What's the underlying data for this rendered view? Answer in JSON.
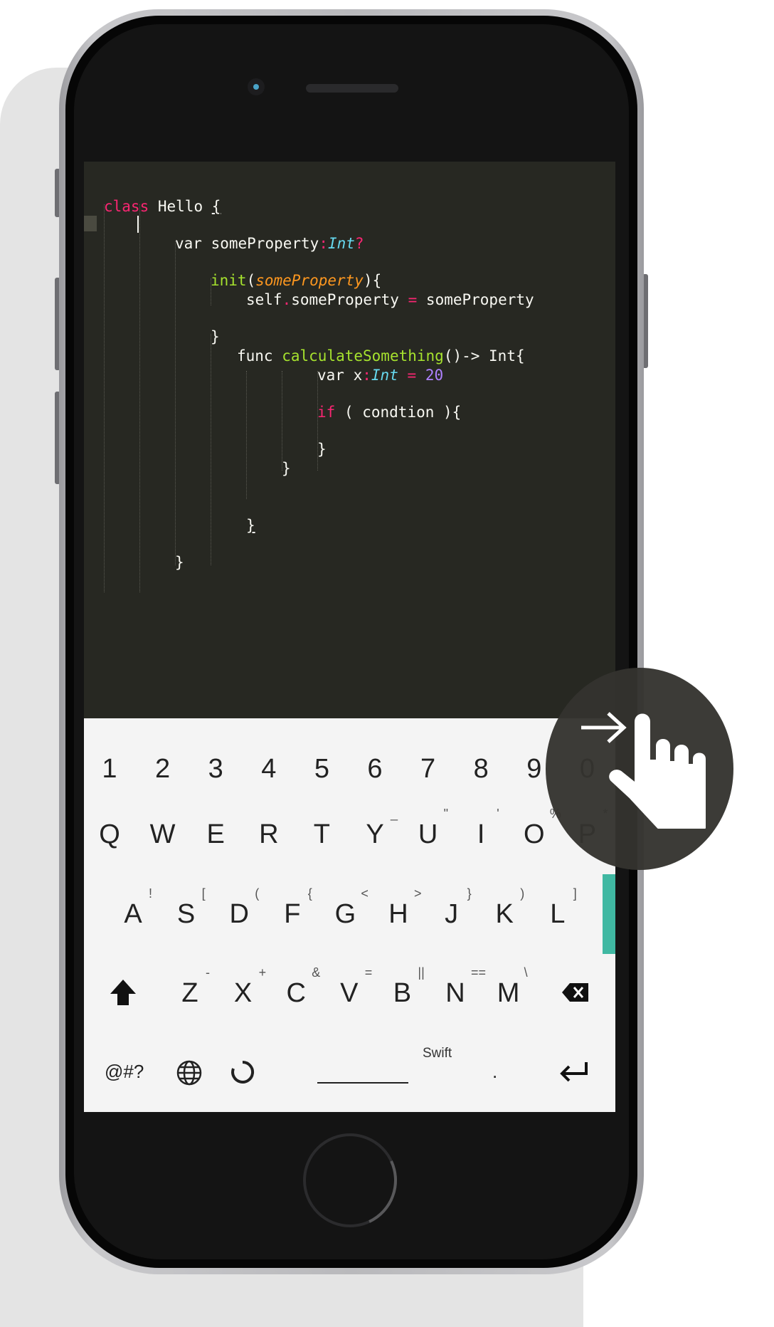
{
  "editor": {
    "lines": [
      {
        "text": "class Hello {"
      },
      {
        "text": "var someProperty:Int?"
      },
      {
        "text": "init(someProperty){"
      },
      {
        "text": "self.someProperty = someProperty"
      },
      {
        "text": "}"
      },
      {
        "text": "func calculateSomething()-> Int{"
      },
      {
        "text": "var x:Int = 20"
      },
      {
        "text": "if ( condtion ){"
      },
      {
        "text": "}"
      },
      {
        "text": "}"
      },
      {
        "text": "}"
      },
      {
        "text": "}"
      }
    ],
    "tokens": {
      "class": "class",
      "hello": "Hello",
      "brace_open": "{",
      "var": "var",
      "some_property": "someProperty",
      "colon": ":",
      "int": "Int",
      "qmark": "?",
      "init": "init",
      "paren_open": "(",
      "param": "someProperty",
      "paren_close_brace": "){",
      "self": "self",
      "dot": ".",
      "eq": "=",
      "assign_val": "someProperty",
      "func": "func",
      "fn_name": "calculateSomething",
      "arrow": "()-> Int{",
      "x": "x",
      "twenty": "20",
      "if": "if",
      "cond": " ( condtion ){",
      "close": "}"
    },
    "colors": {
      "background": "#272822",
      "keyword": "#f92672",
      "function": "#a6e22e",
      "type": "#66d9ef",
      "param": "#fd971f",
      "number": "#ae81ff"
    }
  },
  "keyboard": {
    "number_row": [
      "1",
      "2",
      "3",
      "4",
      "5",
      "6",
      "7",
      "8",
      "9",
      "0"
    ],
    "row1": [
      {
        "key": "Q",
        "hint": ""
      },
      {
        "key": "W",
        "hint": ""
      },
      {
        "key": "E",
        "hint": ""
      },
      {
        "key": "R",
        "hint": ""
      },
      {
        "key": "T",
        "hint": ""
      },
      {
        "key": "Y",
        "hint": "_"
      },
      {
        "key": "U",
        "hint": "\""
      },
      {
        "key": "I",
        "hint": "'"
      },
      {
        "key": "O",
        "hint": "%"
      },
      {
        "key": "P",
        "hint": "*"
      }
    ],
    "row2": [
      {
        "key": "A",
        "hint": "!"
      },
      {
        "key": "S",
        "hint": "["
      },
      {
        "key": "D",
        "hint": "("
      },
      {
        "key": "F",
        "hint": "{"
      },
      {
        "key": "G",
        "hint": "<"
      },
      {
        "key": "H",
        "hint": ">"
      },
      {
        "key": "J",
        "hint": "}"
      },
      {
        "key": "K",
        "hint": ")"
      },
      {
        "key": "L",
        "hint": "]"
      }
    ],
    "row3": [
      {
        "key": "Z",
        "hint": "-"
      },
      {
        "key": "X",
        "hint": "+"
      },
      {
        "key": "C",
        "hint": "&"
      },
      {
        "key": "V",
        "hint": "="
      },
      {
        "key": "B",
        "hint": "||"
      },
      {
        "key": "N",
        "hint": "=="
      },
      {
        "key": "M",
        "hint": "\\"
      }
    ],
    "symbols_key": "@#?",
    "space_language": "Swift",
    "period_key": ".",
    "accent_color": "#40b8a2"
  },
  "icons": {
    "shift": "shift-arrow-icon",
    "backspace": "backspace-icon",
    "globe": "globe-icon",
    "rotate": "rotate-icon",
    "enter": "return-icon",
    "touch": "hand-pointer-icon"
  }
}
